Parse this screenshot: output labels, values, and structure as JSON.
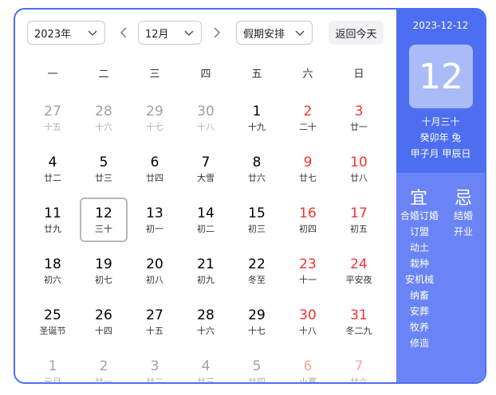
{
  "toolbar": {
    "year_select": "2023年",
    "month_select": "12月",
    "holiday_select": "假期安排",
    "today_button": "返回今天"
  },
  "weekdays": [
    "一",
    "二",
    "三",
    "四",
    "五",
    "六",
    "日"
  ],
  "days": [
    {
      "num": "27",
      "lunar": "十五",
      "other": true
    },
    {
      "num": "28",
      "lunar": "十六",
      "other": true
    },
    {
      "num": "29",
      "lunar": "十七",
      "other": true
    },
    {
      "num": "30",
      "lunar": "十八",
      "other": true
    },
    {
      "num": "1",
      "lunar": "十九"
    },
    {
      "num": "2",
      "lunar": "二十"
    },
    {
      "num": "3",
      "lunar": "廿一"
    },
    {
      "num": "4",
      "lunar": "廿二"
    },
    {
      "num": "5",
      "lunar": "廿三"
    },
    {
      "num": "6",
      "lunar": "廿四"
    },
    {
      "num": "7",
      "lunar": "大雪"
    },
    {
      "num": "8",
      "lunar": "廿六"
    },
    {
      "num": "9",
      "lunar": "廿七"
    },
    {
      "num": "10",
      "lunar": "廿八"
    },
    {
      "num": "11",
      "lunar": "廿九"
    },
    {
      "num": "12",
      "lunar": "三十",
      "selected": true
    },
    {
      "num": "13",
      "lunar": "初一"
    },
    {
      "num": "14",
      "lunar": "初二"
    },
    {
      "num": "15",
      "lunar": "初三"
    },
    {
      "num": "16",
      "lunar": "初四"
    },
    {
      "num": "17",
      "lunar": "初五"
    },
    {
      "num": "18",
      "lunar": "初六"
    },
    {
      "num": "19",
      "lunar": "初七"
    },
    {
      "num": "20",
      "lunar": "初八"
    },
    {
      "num": "21",
      "lunar": "初九"
    },
    {
      "num": "22",
      "lunar": "冬至"
    },
    {
      "num": "23",
      "lunar": "十一"
    },
    {
      "num": "24",
      "lunar": "平安夜"
    },
    {
      "num": "25",
      "lunar": "圣诞节"
    },
    {
      "num": "26",
      "lunar": "十四"
    },
    {
      "num": "27",
      "lunar": "十五"
    },
    {
      "num": "28",
      "lunar": "十六"
    },
    {
      "num": "29",
      "lunar": "十七"
    },
    {
      "num": "30",
      "lunar": "十八"
    },
    {
      "num": "31",
      "lunar": "冬二九"
    },
    {
      "num": "1",
      "lunar": "元旦",
      "other": true
    },
    {
      "num": "2",
      "lunar": "廿一",
      "other": true
    },
    {
      "num": "3",
      "lunar": "廿二",
      "other": true
    },
    {
      "num": "4",
      "lunar": "廿三",
      "other": true
    },
    {
      "num": "5",
      "lunar": "廿四",
      "other": true
    },
    {
      "num": "6",
      "lunar": "小寒",
      "other": true
    },
    {
      "num": "7",
      "lunar": "廿六",
      "other": true
    }
  ],
  "detail": {
    "date": "2023-12-12",
    "big_day": "12",
    "lunar_date": "十月三十",
    "year_ganzhi": "癸卯年 兔",
    "month_day_ganzhi": "甲子月 甲辰日",
    "yi_label": "宜",
    "ji_label": "忌",
    "yi": [
      "合婚订婚",
      "订盟",
      "动土",
      "栽种",
      "安机械",
      "纳畜",
      "安葬",
      "牧养",
      "修造"
    ],
    "ji": [
      "结婚",
      "开业"
    ]
  },
  "colors": {
    "accent": "#4e6ef2",
    "panel_lower": "#6a84f5",
    "weekend_red": "#f73131"
  }
}
